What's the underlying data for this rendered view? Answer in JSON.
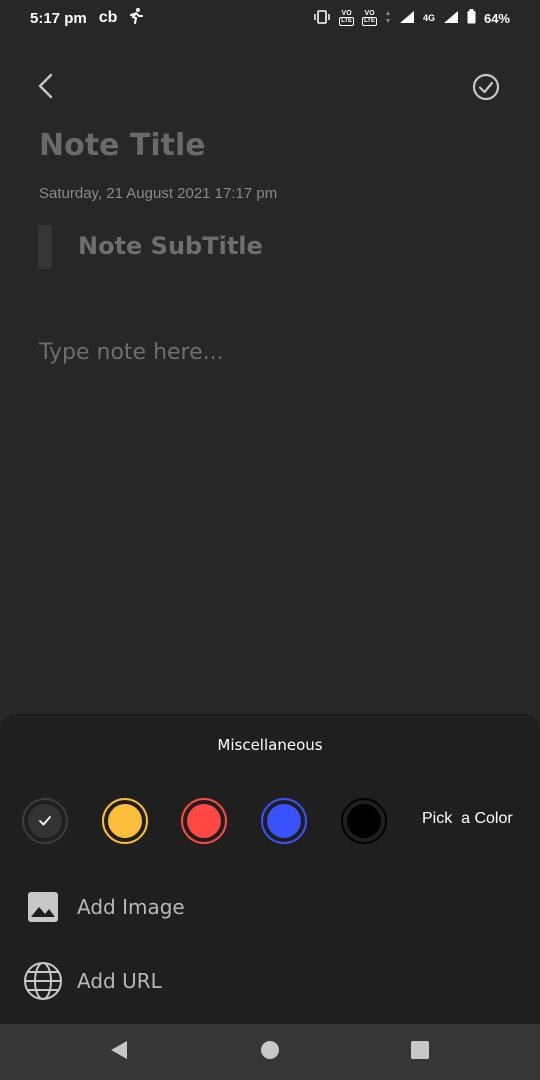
{
  "status_bar": {
    "time": "5:17 pm",
    "app_badge": "cb",
    "network_badge_1": "VO",
    "network_badge_1_sub": "LTE",
    "network_badge_2": "VO",
    "network_badge_2_sub": "LTE",
    "network_type": "4G",
    "battery": "64%"
  },
  "header": {
    "back_icon": "chevron-left-icon",
    "done_icon": "check-circle-icon"
  },
  "note": {
    "title_placeholder": "Note Title",
    "date": "Saturday, 21 August 2021 17:17 pm",
    "subtitle_placeholder": "Note SubTitle",
    "body_placeholder": "Type note here..."
  },
  "sheet": {
    "title": "Miscellaneous",
    "colors": [
      {
        "name": "default",
        "hex": "#333333",
        "ring": "#333333",
        "selected": true
      },
      {
        "name": "yellow",
        "hex": "#FDBE3B",
        "ring": "#FDBE3B",
        "selected": false
      },
      {
        "name": "red",
        "hex": "#FF4842",
        "ring": "#FF4842",
        "selected": false
      },
      {
        "name": "blue",
        "hex": "#3A52FC",
        "ring": "#3A52FC",
        "selected": false
      },
      {
        "name": "black",
        "hex": "#000000",
        "ring": "#000000",
        "selected": false
      }
    ],
    "pick_color_label": "Pick  a Color",
    "add_image_label": "Add Image",
    "add_url_label": "Add URL"
  },
  "nav": {
    "back": "triangle-back-icon",
    "home": "circle-home-icon",
    "recents": "square-recents-icon"
  }
}
